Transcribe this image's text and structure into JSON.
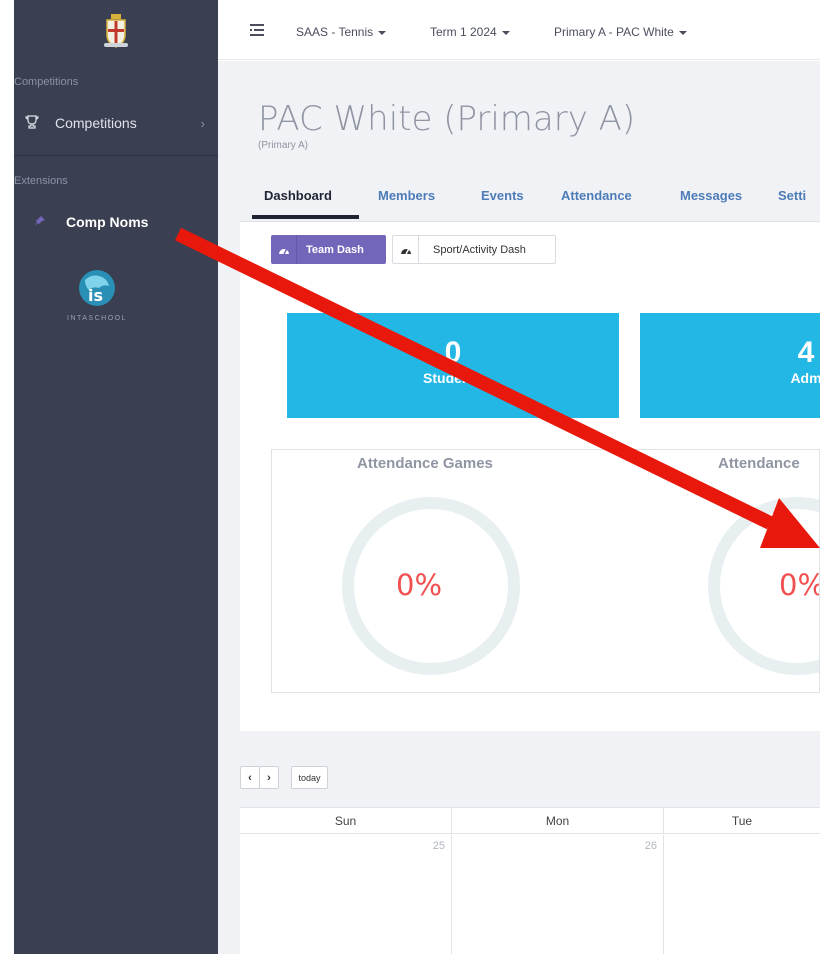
{
  "sidebar": {
    "section_competitions": "Competitions",
    "item_competitions": "Competitions",
    "section_extensions": "Extensions",
    "item_comp_noms": "Comp Noms",
    "intaschool_label": "INTASCHOOL"
  },
  "topbar": {
    "sport": "SAAS - Tennis",
    "term": "Term 1 2024",
    "team": "Primary A - PAC White"
  },
  "page": {
    "title": "PAC White (Primary A)",
    "subtitle": "(Primary A)"
  },
  "tabs": [
    "Dashboard",
    "Members",
    "Events",
    "Attendance",
    "Messages",
    "Setti"
  ],
  "dash_buttons": {
    "team": "Team Dash",
    "sport": "Sport/Activity Dash"
  },
  "stats": [
    {
      "value": "0",
      "label": "Students"
    },
    {
      "value": "4",
      "label": "Adm"
    }
  ],
  "attendance": [
    {
      "title": "Attendance Games",
      "percent": "0%"
    },
    {
      "title": "Attendance",
      "percent": "0%"
    }
  ],
  "calendar": {
    "today_label": "today",
    "days": [
      "Sun",
      "Mon",
      "Tue"
    ],
    "dates": [
      "25",
      "26"
    ]
  },
  "colors": {
    "sidebar_bg": "#3a3f51",
    "primary_button": "#7266ba",
    "stat_tile": "#23b7e5",
    "percent_text": "#f05050",
    "annotation_arrow": "#e8180c"
  }
}
